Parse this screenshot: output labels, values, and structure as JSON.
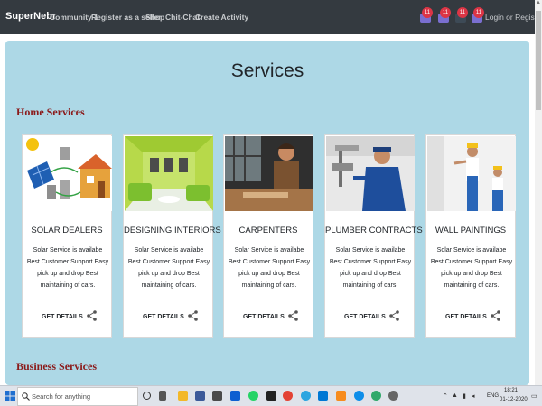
{
  "navbar": {
    "brand": "SuperNebr",
    "links": [
      "Community 1",
      "Register as a seller",
      "Shop",
      "Chit-Chat",
      "Create Activity"
    ],
    "badges": [
      "11",
      "11",
      "11",
      "11"
    ],
    "login": "Login or Register"
  },
  "main": {
    "title": "Services",
    "sections": [
      "Home Services",
      "Business Services"
    ],
    "cards": [
      {
        "title": "SOLAR DEALERS",
        "text": "Solar Service is availabe Best Customer Support Easy pick up and drop Best maintaining of cars.",
        "action": "GET DETAILS",
        "image_icon": "solar-image-icon"
      },
      {
        "title": "DESIGNING INTERIORS",
        "text": "Solar Service is availabe Best Customer Support Easy pick up and drop Best maintaining of cars.",
        "action": "GET DETAILS",
        "image_icon": "interior-image-icon"
      },
      {
        "title": "CARPENTERS",
        "text": "Solar Service is availabe Best Customer Support Easy pick up and drop Best maintaining of cars.",
        "action": "GET DETAILS",
        "image_icon": "carpenter-image-icon"
      },
      {
        "title": "PLUMBER CONTRACTS",
        "text": "Solar Service is availabe Best Customer Support Easy pick up and drop Best maintaining of cars.",
        "action": "GET DETAILS",
        "image_icon": "plumber-image-icon"
      },
      {
        "title": "WALL PAINTINGS",
        "text": "Solar Service is availabe Best Customer Support Easy pick up and drop Best maintaining of cars.",
        "action": "GET DETAILS",
        "image_icon": "painter-image-icon"
      }
    ]
  },
  "taskbar": {
    "search_placeholder": "Search for anything",
    "tray_lang": "ENG",
    "time": "18:21",
    "date": "01-12-2020",
    "apps": [
      "cortana-icon",
      "task-view-icon",
      "file-explorer-icon",
      "store-icon",
      "mail-icon",
      "dropbox-icon",
      "whatsapp-icon",
      "chrome-icon",
      "telegram-icon",
      "vscode-icon",
      "sublime-icon",
      "teamviewer-icon",
      "edge-icon",
      "settings-icon"
    ]
  },
  "colors": {
    "navbar_bg": "#343a40",
    "content_bg": "#add8e6",
    "section_title": "#8b1a1a",
    "badge": "#dc3545"
  }
}
